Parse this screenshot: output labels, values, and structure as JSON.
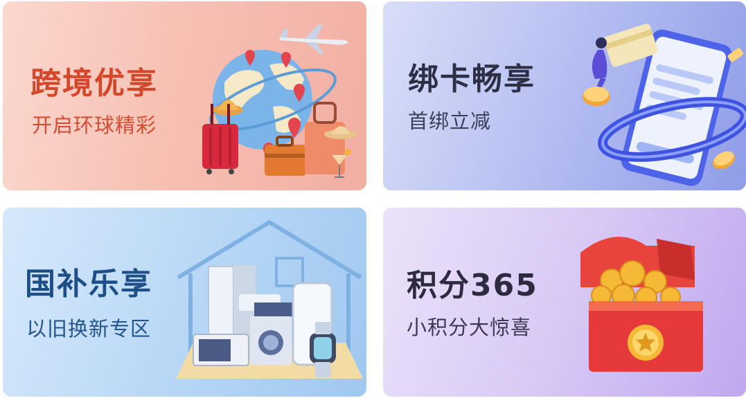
{
  "cards": [
    {
      "title": "跨境优享",
      "subtitle": "开启环球精彩",
      "icon": "travel-globe-icon"
    },
    {
      "title": "绑卡畅享",
      "subtitle": "首绑立减",
      "icon": "phone-card-icon"
    },
    {
      "title": "国补乐享",
      "subtitle": "以旧换新专区",
      "icon": "home-appliances-icon"
    },
    {
      "title": "积分365",
      "subtitle": "小积分大惊喜",
      "icon": "red-envelope-gift-icon"
    }
  ],
  "colors": {
    "card1_title": "#d4472b",
    "card2_title": "#2d3045",
    "card3_title": "#1d4f86",
    "card4_title": "#2e2a3f"
  }
}
